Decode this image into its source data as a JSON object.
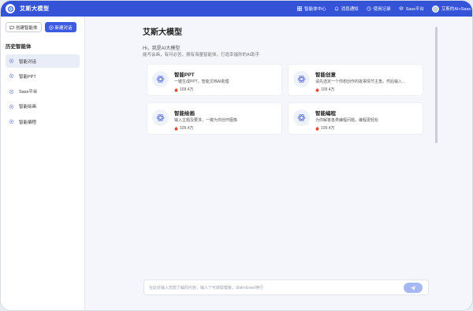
{
  "app": {
    "title": "艾斯大模型"
  },
  "nav": [
    {
      "label": "智能体中心",
      "icon": "grid-icon"
    },
    {
      "label": "消息通知",
      "icon": "bell-icon"
    },
    {
      "label": "使用记录",
      "icon": "clock-icon"
    },
    {
      "label": "Sass平台",
      "icon": "layers-icon"
    },
    {
      "label": "艾斯的AI+Sass",
      "icon": "avatar"
    }
  ],
  "sidebar": {
    "create_agent_label": "创建智能体",
    "new_chat_label": "新建对话",
    "history_title": "历史智能体",
    "items": [
      {
        "label": "智能对话",
        "active": true
      },
      {
        "label": "智能PPT",
        "active": false
      },
      {
        "label": "Sass平台",
        "active": false
      },
      {
        "label": "智能绘画",
        "active": false
      },
      {
        "label": "智能编程",
        "active": false
      }
    ]
  },
  "welcome": {
    "title": "艾斯大模型",
    "greeting": "Hi，我是AI大模型",
    "subtitle": "能写会画，有问必答，拥有海量智能体，打造幸福你的AI助手"
  },
  "cards": [
    {
      "title": "智能PPT",
      "desc": "一键生成PPT，智能文档AI助理",
      "count": "109.4万"
    },
    {
      "title": "智能创意",
      "desc": "请先选定一个你想创作的故事情节主角，然后输入...",
      "count": "109.4万"
    },
    {
      "title": "智能绘画",
      "desc": "输入主题及要求，一键为你创作图像",
      "count": "109.4万"
    },
    {
      "title": "智能编程",
      "desc": "为你解答各类编程问题，编程更轻松",
      "count": "109.4万"
    }
  ],
  "chat": {
    "placeholder": "在此处输入您想了解的内容，输入\"/\"可获取模板，Shift+Enter换行"
  },
  "colors": {
    "brand": "#3553d6",
    "primary_button": "#3d5be0",
    "send_button": "#a5b8f2",
    "hot": "#e8452f"
  }
}
